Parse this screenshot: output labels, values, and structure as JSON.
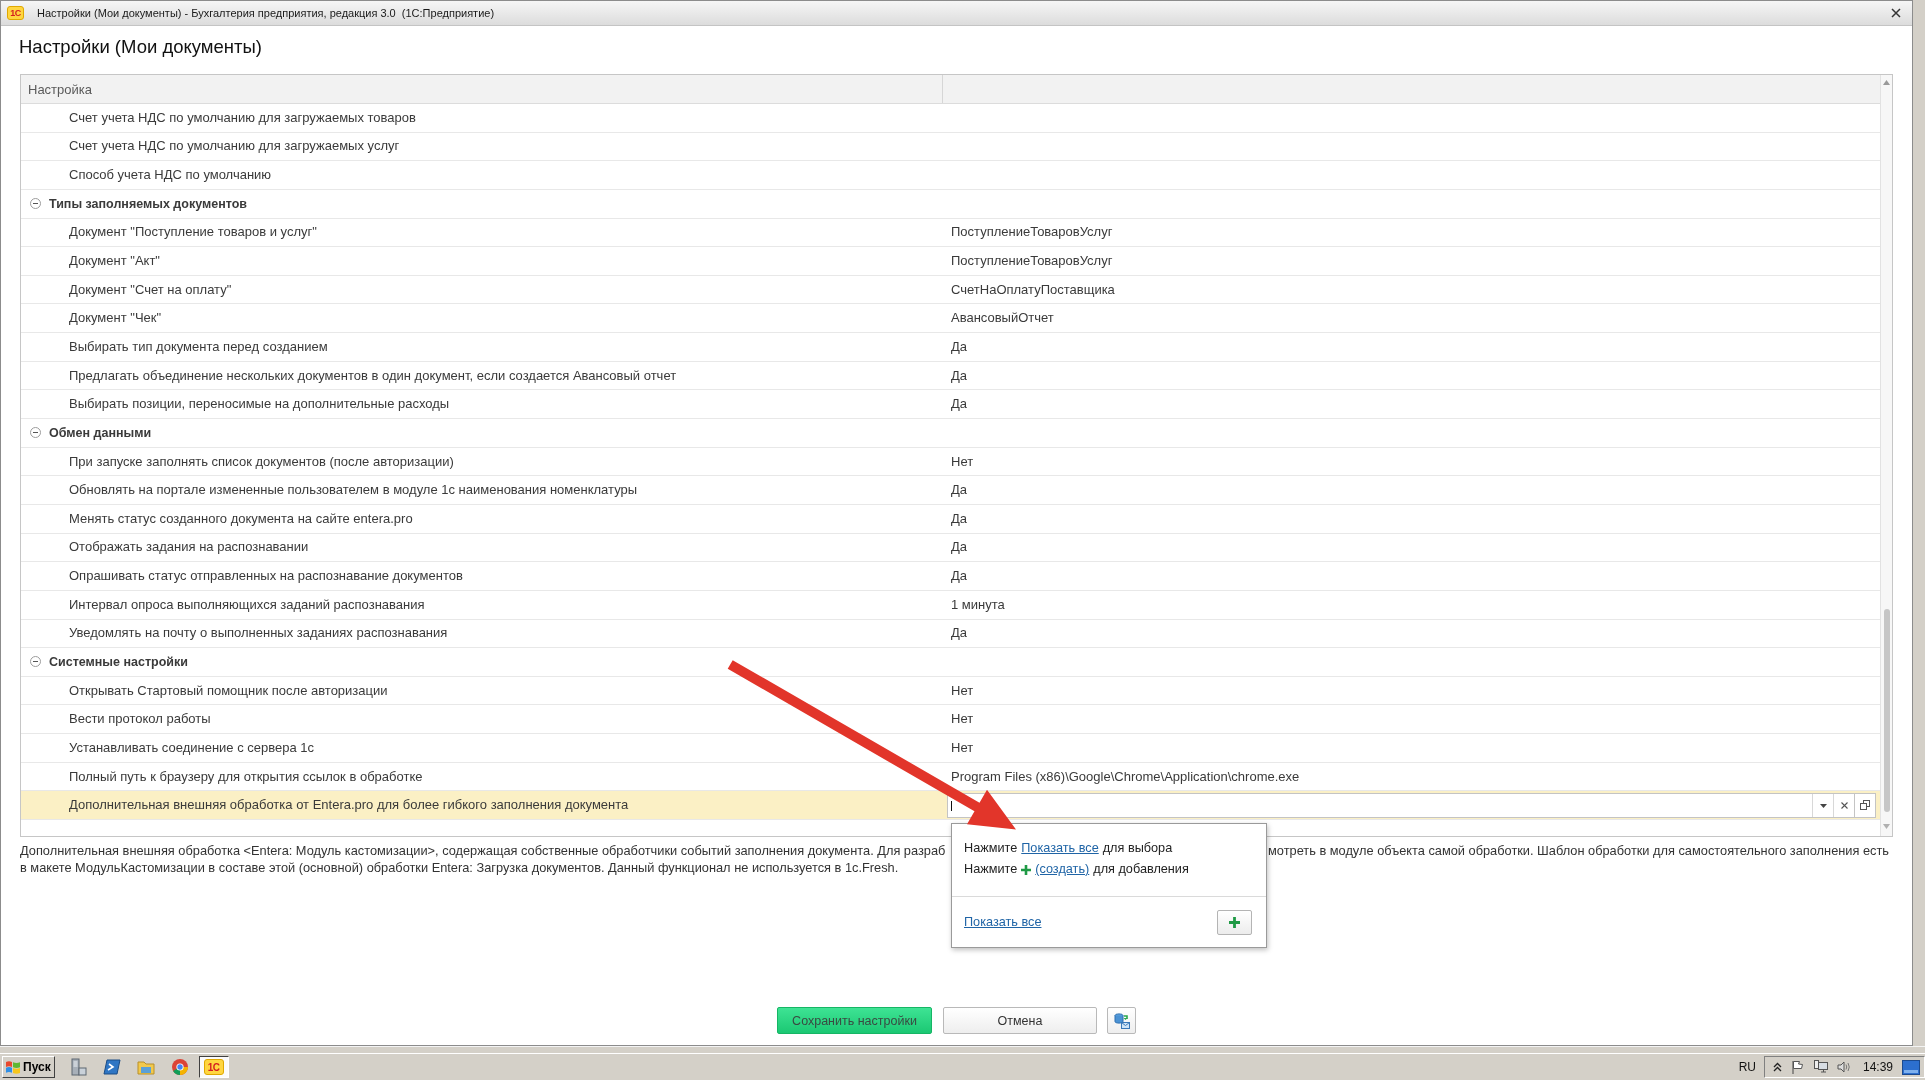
{
  "window": {
    "logo": "1С",
    "title": "Настройки (Мои документы) - Бухгалтерия предприятия, редакция 3.0  (1С:Предприятие)"
  },
  "form": {
    "title": "Настройки (Мои документы)"
  },
  "table": {
    "columns": [
      "Настройка"
    ],
    "rows": [
      {
        "children": [
          {
            "label": "Счет учета НДС по умолчанию для загружаемых товаров",
            "selected": false,
            "editing": false
          },
          {
            "label": "Счет учета НДС по умолчанию для загружаемых услуг",
            "selected": false,
            "editing": false
          },
          {
            "label": "Способ учета НДС по умолчанию",
            "selected": false,
            "editing": false
          }
        ]
      },
      {
        "label": "Типы заполняемых документов",
        "selected": false,
        "expanded": true,
        "children": [
          {
            "label": "Документ \"Поступление товаров и услуг\"",
            "value": "ПоступлениеТоваровУслуг",
            "selected": false,
            "editing": false
          },
          {
            "label": "Документ \"Акт\"",
            "value": "ПоступлениеТоваровУслуг",
            "selected": false,
            "editing": false
          },
          {
            "label": "Документ \"Счет на оплату\"",
            "value": "СчетНаОплатуПоставщика",
            "selected": false,
            "editing": false
          },
          {
            "label": "Документ \"Чек\"",
            "value": "АвансовыйОтчет",
            "selected": false,
            "editing": false
          },
          {
            "label": "Выбирать тип документа перед созданием",
            "value": "Да",
            "selected": false,
            "editing": false
          },
          {
            "label": "Предлагать объединение нескольких документов в один документ, если создается Авансовый отчет",
            "value": "Да",
            "selected": false,
            "editing": false
          },
          {
            "label": "Выбирать позиции, переносимые на дополнительные расходы",
            "value": "Да",
            "selected": false,
            "editing": false
          }
        ]
      },
      {
        "label": "Обмен данными",
        "selected": false,
        "expanded": true,
        "children": [
          {
            "label": "При запуске заполнять список документов (после авторизации)",
            "value": "Нет",
            "selected": false,
            "editing": false
          },
          {
            "label": "Обновлять на портале измененные пользователем в модуле 1с наименования номенклатуры",
            "value": "Да",
            "selected": false,
            "editing": false
          },
          {
            "label": "Менять статус созданного документа на сайте entera.pro",
            "value": "Да",
            "selected": false,
            "editing": false
          },
          {
            "label": "Отображать задания на распознавании",
            "value": "Да",
            "selected": false,
            "editing": false
          },
          {
            "label": "Опрашивать статус отправленных на распознавание документов",
            "value": "Да",
            "selected": false,
            "editing": false
          },
          {
            "label": "Интервал опроса выполняющихся заданий распознавания",
            "value": "1 минута",
            "selected": false,
            "editing": false
          },
          {
            "label": "Уведомлять на почту о выполненных заданиях распознавания",
            "value": "Да",
            "selected": false,
            "editing": false
          }
        ]
      },
      {
        "label": "Системные настройки",
        "selected": false,
        "expanded": true,
        "children": [
          {
            "label": "Открывать Стартовый помощник после авторизации",
            "value": "Нет",
            "selected": false,
            "editing": false
          },
          {
            "label": "Вести протокол работы",
            "value": "Нет",
            "selected": false,
            "editing": false
          },
          {
            "label": "Устанавливать соединение с сервера 1с",
            "value": "Нет",
            "selected": false,
            "editing": false
          },
          {
            "label": "Полный путь к браузеру для открытия ссылок в обработке",
            "value": "Program Files (x86)\\Google\\Chrome\\Application\\chrome.exe",
            "selected": false,
            "editing": false
          },
          {
            "label": "Дополнительная внешняя обработка от Entera.pro для более гибкого заполнения документа",
            "selected": true,
            "editing": true
          }
        ]
      }
    ]
  },
  "description": [
    {
      "segments": [
        "Дополнительная внешняя обработка <Entera: Модуль кастомизации>, содержащая собственные обработчики событий заполнения документа. Для разраб",
        "мотреть в модуле объекта самой обработки. Шаблон обработки для самостоятельного заполнения есть"
      ]
    },
    {
      "segments": [
        "в макете МодульКастомизации в составе этой (основной) обработки Entera: Загрузка документов. Данный функционал не используется в 1с.Fresh."
      ]
    }
  ],
  "popup": {
    "hints": [
      {
        "kind": "choose",
        "before": "Нажмите",
        "link": "Показать все",
        "after": "для выбора"
      },
      {
        "kind": "create",
        "before": "Нажмите",
        "link": "(создать)",
        "after": "для добавления"
      }
    ],
    "footer_link": "Показать все"
  },
  "buttons": [
    {
      "kind": "primary",
      "label": "Сохранить настройки"
    },
    {
      "kind": "default",
      "label": "Отмена"
    },
    {
      "kind": "icon"
    }
  ],
  "taskbar": {
    "start": "Пуск",
    "apps": [
      {
        "kind": "server",
        "selected": false
      },
      {
        "kind": "terminal",
        "selected": false
      },
      {
        "kind": "folder",
        "selected": false
      },
      {
        "kind": "browser",
        "selected": false
      },
      {
        "kind": "onec",
        "logo": "1С",
        "selected": true
      }
    ],
    "language": "RU",
    "clock": "14:39"
  }
}
